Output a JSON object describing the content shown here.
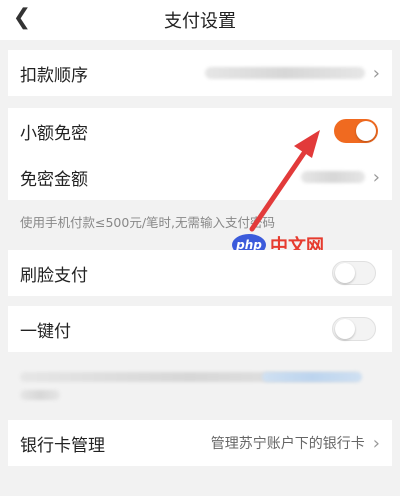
{
  "header": {
    "back_icon": "chevron-left-icon",
    "title": "支付设置"
  },
  "sections": {
    "deduction_order": {
      "label": "扣款顺序"
    },
    "small_amount": {
      "label": "小额免密",
      "enabled": true
    },
    "free_amount": {
      "label": "免密金额"
    },
    "hint": "使用手机付款≤500元/笔时,无需输入支付密码",
    "face_pay": {
      "label": "刷脸支付",
      "enabled": false
    },
    "one_click": {
      "label": "一键付",
      "enabled": false
    },
    "bank_card": {
      "label": "银行卡管理",
      "value": "管理苏宁账户下的银行卡"
    }
  },
  "watermark": {
    "brand": "php",
    "text": "中文网"
  },
  "colors": {
    "toggle_on": "#f06a20",
    "arrow": "#e23a3a",
    "background": "#f2f2f2"
  }
}
